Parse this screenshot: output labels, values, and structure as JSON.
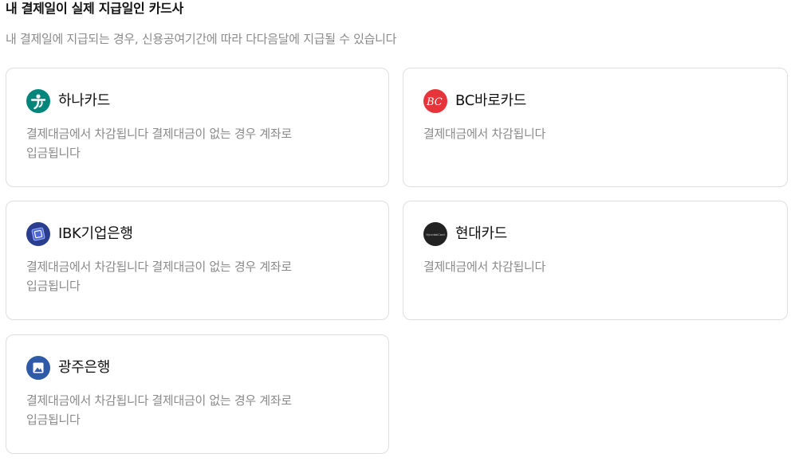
{
  "header": {
    "title": "내 결제일이 실제 지급일인 카드사",
    "subtitle": "내 결제일에 지급되는 경우, 신용공여기간에 따라 다다음달에 지급될 수 있습니다"
  },
  "cards": [
    {
      "name": "하나카드",
      "logo_icon": "hana-card-logo-icon",
      "logo_color": "#00857a",
      "description_lines": [
        "결제대금에서 차감됩니다 결제대금이 없는 경우 계좌로",
        "입금됩니다"
      ]
    },
    {
      "name": "BC바로카드",
      "logo_icon": "bc-card-logo-icon",
      "logo_color": "#e6353a",
      "logo_text": "BC",
      "description_lines": [
        "결제대금에서 차감됩니다"
      ]
    },
    {
      "name": "IBK기업은행",
      "logo_icon": "ibk-bank-logo-icon",
      "logo_color": "#2a3d8f",
      "description_lines": [
        "결제대금에서 차감됩니다 결제대금이 없는 경우 계좌로",
        "입금됩니다"
      ]
    },
    {
      "name": "현대카드",
      "logo_icon": "hyundai-card-logo-icon",
      "logo_color": "#222222",
      "logo_text": "HyundaiCard",
      "description_lines": [
        "결제대금에서 차감됩니다"
      ]
    },
    {
      "name": "광주은행",
      "logo_icon": "kwangju-bank-logo-icon",
      "logo_color": "#2f5aa8",
      "description_lines": [
        "결제대금에서 차감됩니다 결제대금이 없는 경우 계좌로",
        "입금됩니다"
      ]
    }
  ]
}
